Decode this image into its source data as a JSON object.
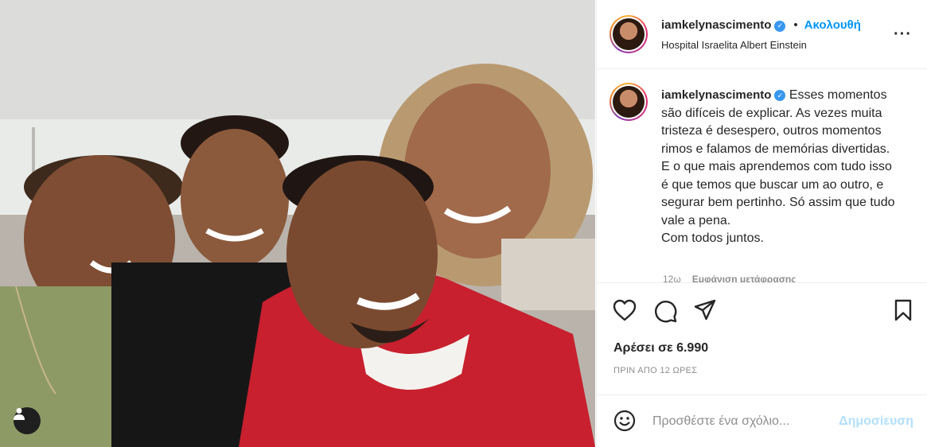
{
  "post": {
    "username": "iamkelynascimento",
    "verified": true,
    "follow_label": "Ακολουθή",
    "location": "Hospital Israelita Albert Einstein",
    "more_icon": "more-horizontal-icon"
  },
  "caption": {
    "username": "iamkelynascimento",
    "text": "Esses momentos são difíceis de explicar. As vezes muita tristeza é desespero, outros momentos rimos e falamos de memórias divertidas.\nE o que mais aprendemos com tudo isso é que temos que buscar um ao outro, e segurar bem pertinho. Só assim que tudo vale a pena.\nCom todos juntos.",
    "age": "12ω",
    "translate_label": "Εμφάνιση μετάφρασης"
  },
  "actions": {
    "like_icon": "heart-icon",
    "comment_icon": "comment-icon",
    "share_icon": "send-icon",
    "save_icon": "bookmark-icon"
  },
  "likes_text": "Αρέσει σε 6.990",
  "time_text": "ΠΡΙΝ ΑΠΟ 12 ΩΡΕΣ",
  "comment": {
    "placeholder": "Προσθέστε ένα σχόλιο...",
    "post_label": "Δημοσίευση",
    "emoji_icon": "emoji-icon"
  },
  "photo": {
    "tag_icon": "user-tag-icon"
  },
  "colors": {
    "accent": "#0095f6",
    "post_disabled": "#b2dffc",
    "verified": "#3897f0",
    "hoodie": "#c8202e"
  }
}
